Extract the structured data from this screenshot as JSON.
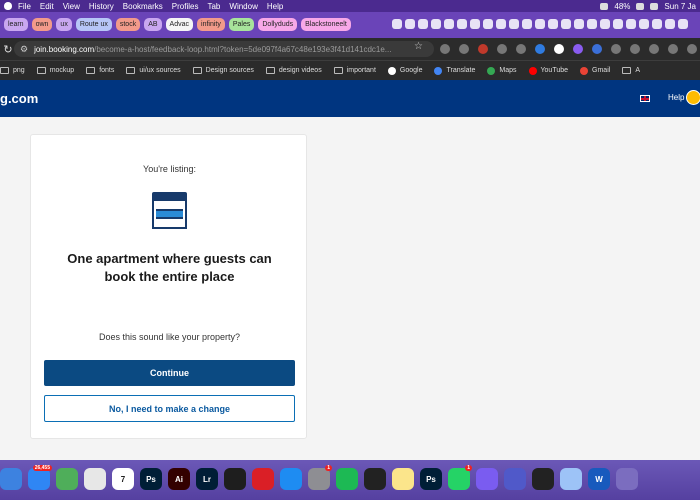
{
  "menubar": {
    "items": [
      "File",
      "Edit",
      "View",
      "History",
      "Bookmarks",
      "Profiles",
      "Tab",
      "Window",
      "Help"
    ],
    "battery": "48%",
    "clock": "Sun 7 Ja"
  },
  "tabstrip": {
    "tabs": [
      {
        "label": "learn",
        "color": "#c9a7f0"
      },
      {
        "label": "own",
        "color": "#f29a8a"
      },
      {
        "label": "ux",
        "color": "#c9a7f0"
      },
      {
        "label": "Route ux",
        "color": "#b7c6f7"
      },
      {
        "label": "stock",
        "color": "#f29a8a"
      },
      {
        "label": "AB",
        "color": "#c9a7f0"
      },
      {
        "label": "Advac",
        "color": "#f5f5f5"
      },
      {
        "label": "infinity",
        "color": "#f29a8a"
      },
      {
        "label": "Pales",
        "color": "#a7e39b"
      },
      {
        "label": "Dollyduds",
        "color": "#f7a8e8"
      },
      {
        "label": "Blackstoneelt",
        "color": "#f7a8e8"
      }
    ]
  },
  "address": {
    "host": "join.booking.com",
    "path": "/become-a-host/feedback-loop.html?token=5de097f4a67c48e193e3f41d141cdc1e..."
  },
  "bookmarks": [
    {
      "label": "png",
      "icon": "folder-icon"
    },
    {
      "label": "mockup",
      "icon": "folder-icon"
    },
    {
      "label": "fonts",
      "icon": "folder-icon"
    },
    {
      "label": "ui/ux sources",
      "icon": "folder-icon"
    },
    {
      "label": "Design sources",
      "icon": "folder-icon"
    },
    {
      "label": "design videos",
      "icon": "folder-icon"
    },
    {
      "label": "important",
      "icon": "folder-icon"
    },
    {
      "label": "Google",
      "icon": "google-icon"
    },
    {
      "label": "Translate",
      "icon": "translate-icon"
    },
    {
      "label": "Maps",
      "icon": "maps-icon"
    },
    {
      "label": "YouTube",
      "icon": "youtube-icon"
    },
    {
      "label": "Gmail",
      "icon": "gmail-icon"
    },
    {
      "label": "A",
      "icon": "folder-icon"
    }
  ],
  "site": {
    "logo": "g.com",
    "help": "Help",
    "brand_color": "#003580"
  },
  "card": {
    "listing_label": "You're listing:",
    "property_title": "One apartment where guests can book the entire place",
    "question": "Does this sound like your property?",
    "continue_label": "Continue",
    "change_label": "No, I need to make a change"
  },
  "dock": {
    "apps": [
      {
        "name": "finder",
        "color": "#3d82e0",
        "label": ""
      },
      {
        "name": "mail",
        "color": "#2f86f4",
        "label": "",
        "badge": "26,455"
      },
      {
        "name": "maps",
        "color": "#4fae5a",
        "label": ""
      },
      {
        "name": "chrome",
        "color": "#e7e7e7",
        "label": ""
      },
      {
        "name": "calendar",
        "color": "#ffffff",
        "label": "7"
      },
      {
        "name": "photoshop",
        "color": "#001e36",
        "label": "Ps"
      },
      {
        "name": "illustrator",
        "color": "#330000",
        "label": "Ai"
      },
      {
        "name": "lightroom",
        "color": "#001e36",
        "label": "Lr"
      },
      {
        "name": "figma",
        "color": "#1e1e1e",
        "label": ""
      },
      {
        "name": "creative-cloud",
        "color": "#da1f26",
        "label": ""
      },
      {
        "name": "app-store",
        "color": "#1e8cf2",
        "label": ""
      },
      {
        "name": "settings",
        "color": "#8e8e93",
        "label": "",
        "badge": "1"
      },
      {
        "name": "spotify",
        "color": "#1db954",
        "label": ""
      },
      {
        "name": "activity",
        "color": "#222222",
        "label": ""
      },
      {
        "name": "notes",
        "color": "#fbe58b",
        "label": ""
      },
      {
        "name": "photoshop-2",
        "color": "#001e36",
        "label": "Ps"
      },
      {
        "name": "whatsapp",
        "color": "#25d366",
        "label": "",
        "badge": "1"
      },
      {
        "name": "shortcuts",
        "color": "#7a5cf0",
        "label": ""
      },
      {
        "name": "teams",
        "color": "#5059c9",
        "label": ""
      },
      {
        "name": "quicktime",
        "color": "#222222",
        "label": ""
      },
      {
        "name": "preview",
        "color": "#9dc3f7",
        "label": ""
      },
      {
        "name": "word",
        "color": "#185abd",
        "label": "W"
      },
      {
        "name": "extra",
        "color": "#7b6dbf",
        "label": ""
      }
    ]
  }
}
